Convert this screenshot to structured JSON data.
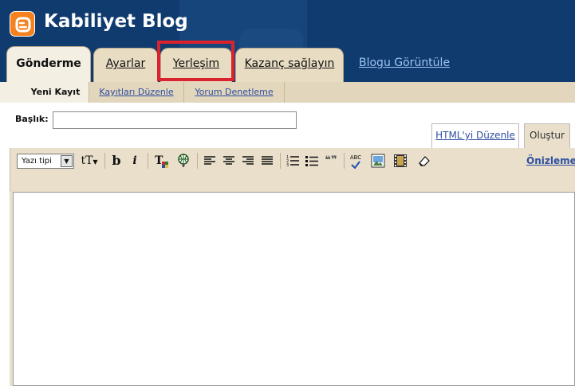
{
  "header": {
    "blog_title": "Kabiliyet Blog",
    "logo_icon": "blogger-logo-icon",
    "background_color": "#0f3b6e",
    "logo_color": "#f58220"
  },
  "main_tabs": [
    {
      "label": "Gönderme",
      "active": true
    },
    {
      "label": "Ayarlar",
      "active": false
    },
    {
      "label": "Yerleşim",
      "active": false,
      "highlighted": true
    },
    {
      "label": "Kazanç sağlayın",
      "active": false
    }
  ],
  "view_blog_link": "Blogu Görüntüle",
  "sub_tabs": [
    {
      "label": "Yeni Kayıt",
      "active": true
    },
    {
      "label": "Kayıtları Düzenle",
      "active": false
    },
    {
      "label": "Yorum Denetleme",
      "active": false
    }
  ],
  "post_form": {
    "title_label": "Başlık:",
    "title_value": "",
    "title_placeholder": ""
  },
  "editor_modes": [
    {
      "label": "HTML'yi Düzenle",
      "active": false
    },
    {
      "label": "Oluştur",
      "active": true
    }
  ],
  "toolbar": {
    "font_select_value": "Yazı tipi",
    "font_size_glyph": "tT",
    "bold_glyph": "b",
    "italic_glyph": "i",
    "text_color_glyph": "T",
    "quote_glyph": "❝❞",
    "spell_glyph": "ABC",
    "preview_label": "Önizleme",
    "highlight_color": "#d9232e"
  },
  "editor": {
    "content": ""
  }
}
